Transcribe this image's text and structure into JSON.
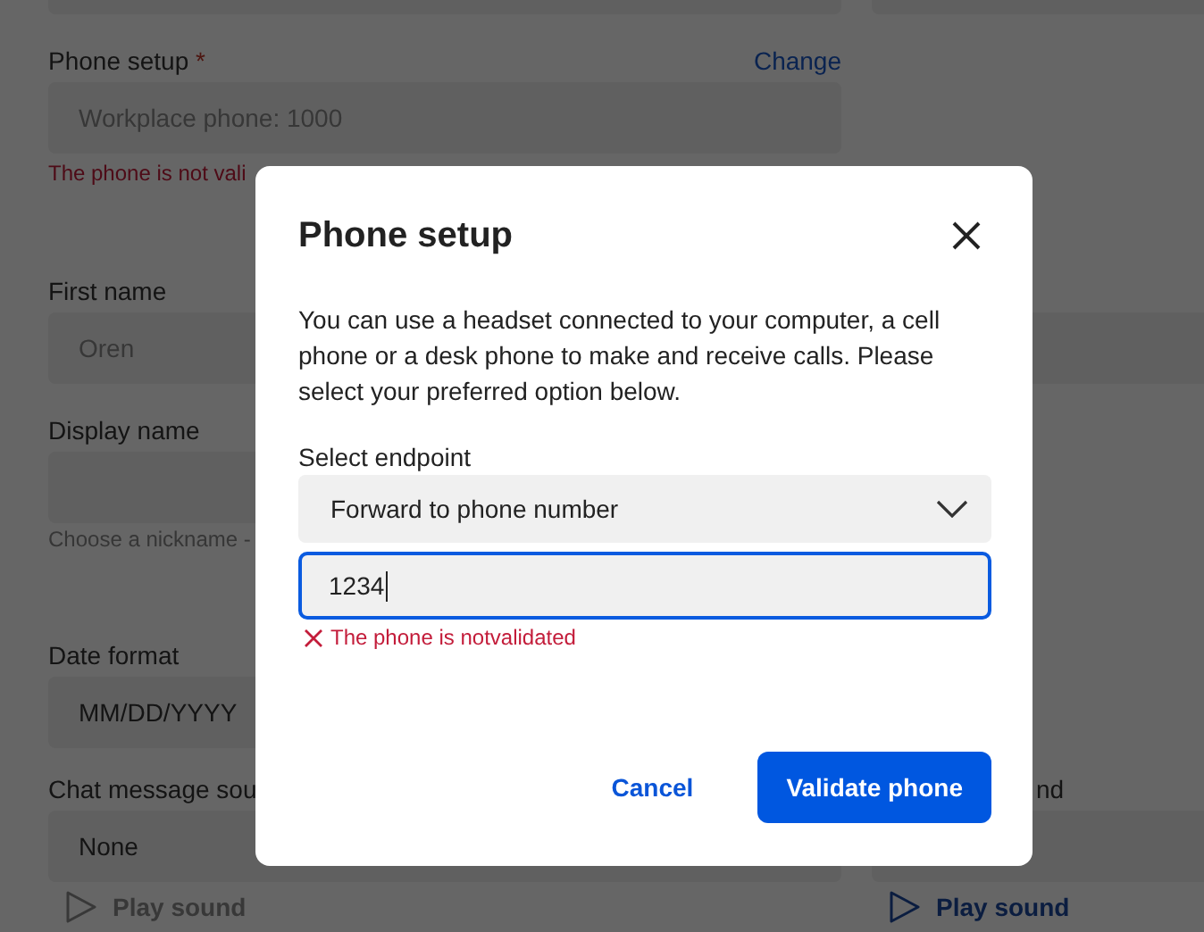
{
  "form": {
    "left": [
      {
        "kind": "input"
      },
      {
        "kind": "input",
        "label": "Phone setup",
        "required_mark": "*",
        "action": "Change",
        "value": "Workplace phone: 1000",
        "disabled": true,
        "error": "The phone is not vali"
      },
      {
        "kind": "input",
        "label": "First name",
        "value": "Oren",
        "disabled": true
      },
      {
        "kind": "input",
        "label": "Display name",
        "hint": "Choose a nickname -"
      },
      {
        "kind": "input",
        "label": "Date format",
        "value": "MM/DD/YYYY"
      },
      {
        "kind": "input",
        "label": "Chat message sou",
        "value": "None"
      },
      {
        "kind": "play",
        "label": "Play sound",
        "disabled": true
      }
    ],
    "right": [
      {
        "kind": "input"
      },
      {
        "kind": "input"
      },
      {
        "kind": "input",
        "label": "nd"
      },
      {
        "kind": "play",
        "label": "Play sound",
        "disabled": false
      }
    ]
  },
  "dialog": {
    "title": "Phone setup",
    "description": "You can use a headset connected to your computer, a cell phone or a desk phone to make and receive calls. Please select your preferred option below.",
    "endpoint_label": "Select endpoint",
    "endpoint": "Forward to phone number",
    "phone_value": "1234",
    "error": "The phone is notvalidated",
    "buttons": [
      {
        "label": "Cancel",
        "kind": "text"
      },
      {
        "label": "Validate phone",
        "kind": "primary"
      }
    ]
  }
}
